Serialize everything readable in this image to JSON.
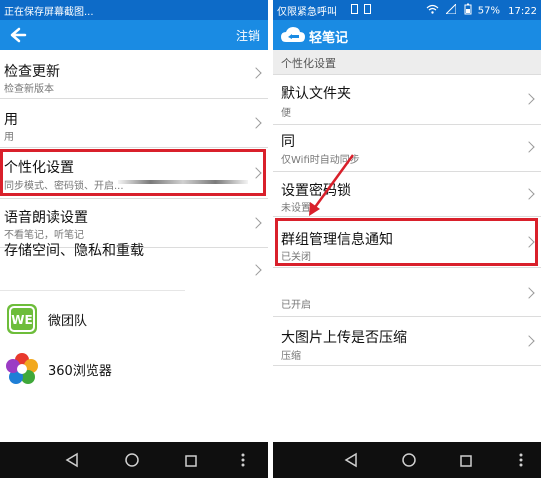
{
  "left": {
    "status": {
      "text": "正在保存屏幕截图..."
    },
    "titlebar": {
      "action": "注销"
    },
    "settings": [
      {
        "title": "检查更新",
        "subtitle": "检查新版本"
      },
      {
        "title": "用",
        "subtitle": "用"
      },
      {
        "title": "个性化设置",
        "subtitle": "同步模式、密码锁、开启..."
      },
      {
        "title": "语音朗读设置",
        "subtitle": "不看笔记，听笔记"
      },
      {
        "title": "存储空间、隐私和重载",
        "subtitle": ""
      }
    ],
    "apps": [
      {
        "name": "微团队",
        "icon": "we-team-icon"
      },
      {
        "name": "360浏览器",
        "icon": "360-browser-icon"
      }
    ]
  },
  "right": {
    "status": {
      "carrier": "仅限紧急呼叫",
      "battery": "57%",
      "time": "17:22"
    },
    "titlebar": {
      "title": "轻笔记"
    },
    "section_header": "个性化设置",
    "settings": [
      {
        "title": "默认文件夹",
        "subtitle": "便"
      },
      {
        "title": "同",
        "subtitle": "仅Wifi时自动同步"
      },
      {
        "title": "设置密码锁",
        "subtitle": "未设置"
      },
      {
        "title": "群组管理信息通知",
        "subtitle": "已关闭"
      },
      {
        "title": "",
        "subtitle": ""
      },
      {
        "title": "",
        "subtitle": "已开启"
      },
      {
        "title": "大图片上传是否压缩",
        "subtitle": "压缩"
      }
    ]
  },
  "colors": {
    "status_bar": "#0d6bc8",
    "title_bar": "#1a8be3",
    "highlight": "#d9202b",
    "nav_bar": "#0f0f0f"
  }
}
